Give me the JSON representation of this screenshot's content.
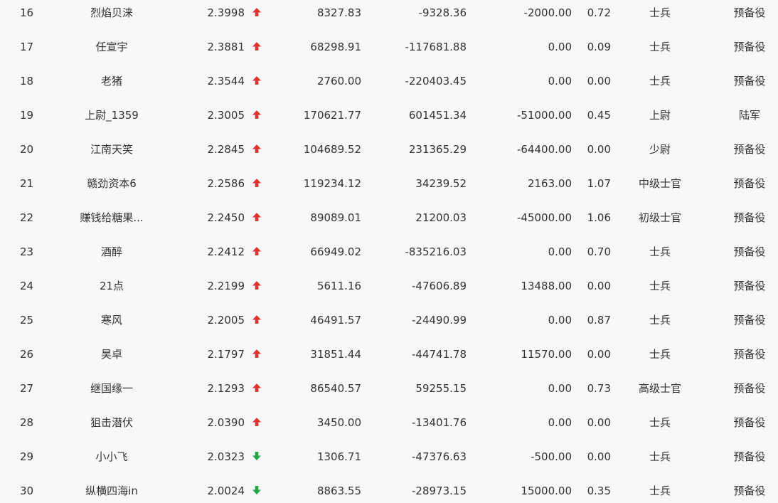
{
  "colors": {
    "up": "#e8302c",
    "down": "#22a845",
    "text": "#333333",
    "background": "#f7f8fa"
  },
  "rows": [
    {
      "rank": "16",
      "name": "烈焰贝涞",
      "score": "2.3998",
      "trend": "up",
      "value1": "8327.83",
      "value2": "-9328.36",
      "value3": "-2000.00",
      "ratio": "0.72",
      "rank_title": "士兵",
      "branch": "预备役"
    },
    {
      "rank": "17",
      "name": "任宣宇",
      "score": "2.3881",
      "trend": "up",
      "value1": "68298.91",
      "value2": "-117681.88",
      "value3": "0.00",
      "ratio": "0.09",
      "rank_title": "士兵",
      "branch": "预备役"
    },
    {
      "rank": "18",
      "name": "老猪",
      "score": "2.3544",
      "trend": "up",
      "value1": "2760.00",
      "value2": "-220403.45",
      "value3": "0.00",
      "ratio": "0.00",
      "rank_title": "士兵",
      "branch": "预备役"
    },
    {
      "rank": "19",
      "name": "上尉_1359",
      "score": "2.3005",
      "trend": "up",
      "value1": "170621.77",
      "value2": "601451.34",
      "value3": "-51000.00",
      "ratio": "0.45",
      "rank_title": "上尉",
      "branch": "陆军"
    },
    {
      "rank": "20",
      "name": "江南天笑",
      "score": "2.2845",
      "trend": "up",
      "value1": "104689.52",
      "value2": "231365.29",
      "value3": "-64400.00",
      "ratio": "0.00",
      "rank_title": "少尉",
      "branch": "预备役"
    },
    {
      "rank": "21",
      "name": "赣劲资本6",
      "score": "2.2586",
      "trend": "up",
      "value1": "119234.12",
      "value2": "34239.52",
      "value3": "2163.00",
      "ratio": "1.07",
      "rank_title": "中级士官",
      "branch": "预备役"
    },
    {
      "rank": "22",
      "name": "赚钱给糖果...",
      "score": "2.2450",
      "trend": "up",
      "value1": "89089.01",
      "value2": "21200.03",
      "value3": "-45000.00",
      "ratio": "1.06",
      "rank_title": "初级士官",
      "branch": "预备役"
    },
    {
      "rank": "23",
      "name": "酒醉",
      "score": "2.2412",
      "trend": "up",
      "value1": "66949.02",
      "value2": "-835216.03",
      "value3": "0.00",
      "ratio": "0.70",
      "rank_title": "士兵",
      "branch": "预备役"
    },
    {
      "rank": "24",
      "name": "21点",
      "score": "2.2199",
      "trend": "up",
      "value1": "5611.16",
      "value2": "-47606.89",
      "value3": "13488.00",
      "ratio": "0.00",
      "rank_title": "士兵",
      "branch": "预备役"
    },
    {
      "rank": "25",
      "name": "寒风",
      "score": "2.2005",
      "trend": "up",
      "value1": "46491.57",
      "value2": "-24490.99",
      "value3": "0.00",
      "ratio": "0.87",
      "rank_title": "士兵",
      "branch": "预备役"
    },
    {
      "rank": "26",
      "name": "昊卓",
      "score": "2.1797",
      "trend": "up",
      "value1": "31851.44",
      "value2": "-44741.78",
      "value3": "11570.00",
      "ratio": "0.00",
      "rank_title": "士兵",
      "branch": "预备役"
    },
    {
      "rank": "27",
      "name": "继国缘一",
      "score": "2.1293",
      "trend": "up",
      "value1": "86540.57",
      "value2": "59255.15",
      "value3": "0.00",
      "ratio": "0.73",
      "rank_title": "高级士官",
      "branch": "预备役"
    },
    {
      "rank": "28",
      "name": "狙击潜伏",
      "score": "2.0390",
      "trend": "up",
      "value1": "3450.00",
      "value2": "-13401.76",
      "value3": "0.00",
      "ratio": "0.00",
      "rank_title": "士兵",
      "branch": "预备役"
    },
    {
      "rank": "29",
      "name": "小小飞",
      "score": "2.0323",
      "trend": "down",
      "value1": "1306.71",
      "value2": "-47376.63",
      "value3": "-500.00",
      "ratio": "0.00",
      "rank_title": "士兵",
      "branch": "预备役"
    },
    {
      "rank": "30",
      "name": "纵横四海in",
      "score": "2.0024",
      "trend": "down",
      "value1": "8863.55",
      "value2": "-28973.15",
      "value3": "15000.00",
      "ratio": "0.35",
      "rank_title": "士兵",
      "branch": "预备役"
    }
  ]
}
